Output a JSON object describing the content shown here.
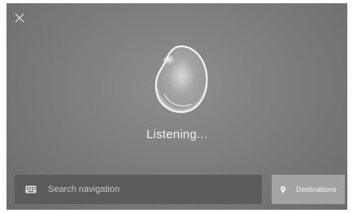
{
  "header": {
    "close_icon": "close-icon"
  },
  "assistant": {
    "orb_icon": "voice-orb-icon",
    "status_text": "Listening..."
  },
  "search": {
    "icon": "keyboard-icon",
    "placeholder": "Search navigation"
  },
  "destinations": {
    "icon": "map-pin-icon",
    "label": "Destinations"
  },
  "colors": {
    "background": "#7a7a7a",
    "search_bar": "#5b5b5b",
    "destinations_button": "#a3a3a3",
    "text": "#f2f2f2"
  }
}
